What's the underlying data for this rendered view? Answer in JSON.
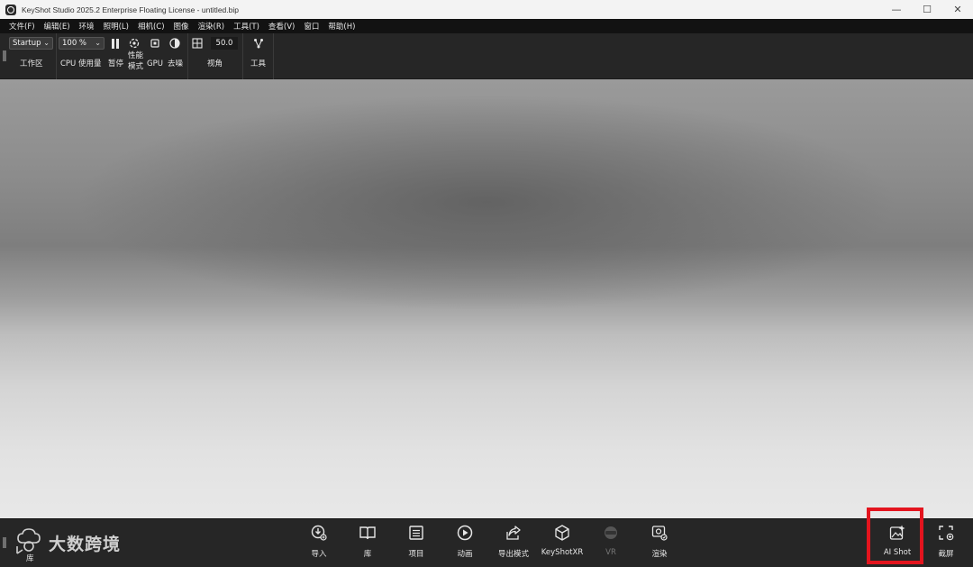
{
  "window": {
    "title": "KeyShot Studio 2025.2 Enterprise Floating License  - untitled.bip",
    "controls": {
      "minimize": "—",
      "maximize": "☐",
      "close": "✕"
    }
  },
  "menu": [
    "文件(F)",
    "编辑(E)",
    "环境",
    "照明(L)",
    "相机(C)",
    "图像",
    "渲染(R)",
    "工具(T)",
    "查看(V)",
    "窗口",
    "帮助(H)"
  ],
  "toolbar": {
    "workspace": {
      "value": "Startup",
      "label": "工作区"
    },
    "cpu": {
      "value": "100 %",
      "label": "CPU 使用量"
    },
    "pause_label": "暂停",
    "perf_label_line1": "性能",
    "perf_label_line2": "模式",
    "gpu_label": "GPU",
    "denoise_label": "去噪",
    "view": {
      "value": "50.0",
      "label": "视角"
    },
    "tools_label": "工具"
  },
  "bottom": {
    "library_label": "库",
    "watermark": "大数跨境",
    "items": [
      {
        "name": "import",
        "label": "导入",
        "icon": "import-icon"
      },
      {
        "name": "library",
        "label": "库",
        "icon": "book-icon"
      },
      {
        "name": "project",
        "label": "项目",
        "icon": "list-icon"
      },
      {
        "name": "animation",
        "label": "动画",
        "icon": "play-icon"
      },
      {
        "name": "export",
        "label": "导出模式",
        "icon": "share-icon"
      },
      {
        "name": "keyshotxr",
        "label": "KeyShotXR",
        "icon": "cube-icon"
      },
      {
        "name": "vr",
        "label": "VR",
        "icon": "vr-icon"
      },
      {
        "name": "render",
        "label": "渲染",
        "icon": "render-icon"
      },
      {
        "name": "aishot",
        "label": "AI Shot",
        "icon": "ai-image-icon"
      },
      {
        "name": "screenshot",
        "label": "截屏",
        "icon": "screenshot-icon"
      }
    ]
  },
  "colors": {
    "highlight": "#e3141e",
    "bar_bg": "#262626"
  }
}
